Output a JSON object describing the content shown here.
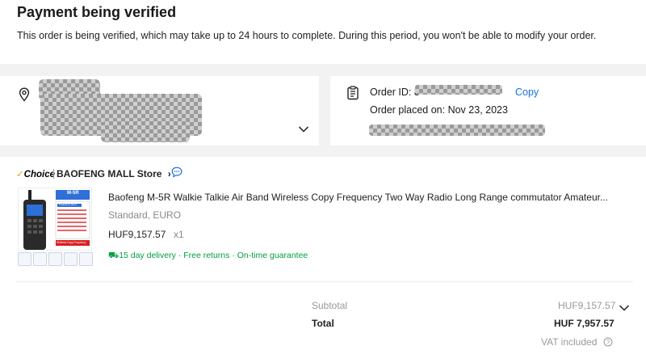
{
  "status": {
    "title": "Payment being verified",
    "description": "This order is being verified, which may take up to 24 hours to complete. During this period, you won't be able to modify your order."
  },
  "address": {
    "icon": "location-pin-icon",
    "expand_icon": "chevron-down-icon"
  },
  "order": {
    "icon": "clipboard-icon",
    "id_label": "Order ID: 8",
    "copy_label": "Copy",
    "placed_label": "Order placed on: Nov 23, 2023"
  },
  "store": {
    "choice_label": "Choice",
    "name": "BAOFENG MALL Store",
    "chevron": "›",
    "chat_icon": "chat-bubble-icon"
  },
  "product": {
    "title": "Baofeng M-5R Walkie Talkie Air Band Wireless Copy Frequency Two Way Radio Long Range commutator Amateur...",
    "variant": "Standard, EURO",
    "price": "HUF9,157.57",
    "quantity": "x1",
    "thumb_model": "M-5R",
    "thumb_tag1": "Frequency band",
    "thumb_tag2": "Wireless Copy Frequency",
    "guarantees": [
      "15 day delivery",
      "Free returns",
      "On-time guarantee"
    ]
  },
  "summary": {
    "subtotal_label": "Subtotal",
    "subtotal_value": "HUF9,157.57",
    "total_label": "Total",
    "total_value": "HUF 7,957.57",
    "vat_label": "VAT included"
  },
  "colors": {
    "link": "#1a6fe0",
    "guarantee": "#00a03c",
    "choice_tick": "#f5a300"
  }
}
